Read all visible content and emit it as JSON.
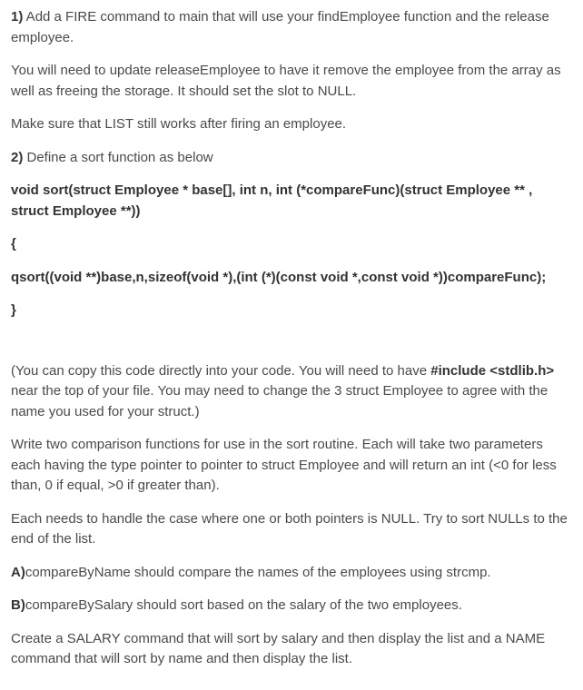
{
  "p1": {
    "label": "1)",
    "text": " Add a FIRE command to main that will use your findEmployee function and the release employee."
  },
  "p2": "You will need to update releaseEmployee to have it remove the employee from the array as well as freeing the storage. It should set the slot to NULL.",
  "p3": "Make sure that LIST still works after firing an employee.",
  "p4": {
    "label": "2)",
    "text": " Define a sort function as below"
  },
  "code": {
    "sig": "void sort(struct Employee * base[], int n, int (*compareFunc)(struct Employee ** , struct Employee **))",
    "open": "{",
    "body": "   qsort((void **)base,n,sizeof(void *),(int (*)(const void *,const void *))compareFunc);",
    "close": "}"
  },
  "p5": {
    "pre": "(You can copy this code directly into your code. You will need to have ",
    "bold1": "#include <stdlib.h>",
    "post": " near the top of your file. You may need to change the 3 struct Employee to agree with the name you used for your struct.)"
  },
  "p6": "Write two comparison functions for use in the sort routine. Each will take two parameters each having the type pointer to pointer to struct Employee and will return an int (<0 for less than, 0 if equal, >0 if greater than).",
  "p7": "Each needs to handle the case where one or both pointers is NULL. Try to sort NULLs to the end of the list.",
  "p8": {
    "label": "A)",
    "text": "compareByName should compare the names of the employees using strcmp."
  },
  "p9": {
    "label": "B)",
    "text": "compareBySalary should sort based on the salary of the two employees."
  },
  "p10": "Create a SALARY command that will sort by salary and then display the list and a NAME command that will sort by name and then display the list."
}
